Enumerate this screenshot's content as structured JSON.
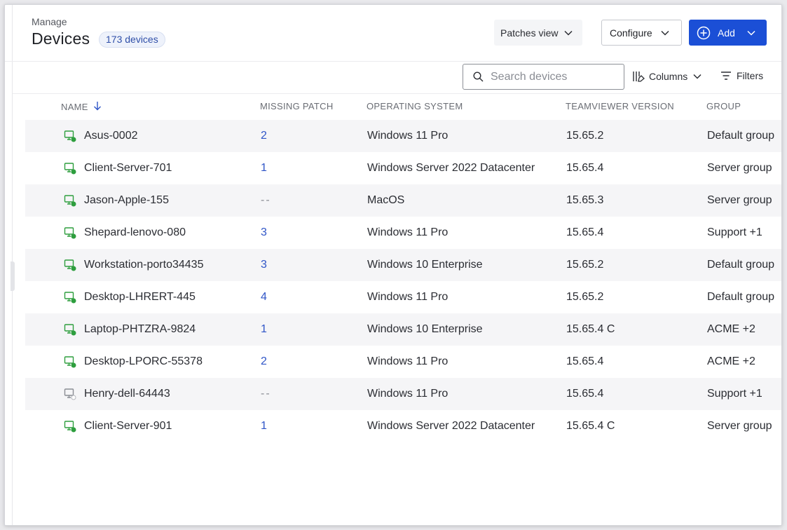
{
  "header": {
    "breadcrumb": "Manage",
    "title": "Devices",
    "count_badge": "173 devices",
    "patches_view_label": "Patches view",
    "configure_label": "Configure",
    "add_label": "Add"
  },
  "toolbar": {
    "search_placeholder": "Search devices",
    "columns_label": "Columns",
    "filters_label": "Filters"
  },
  "table": {
    "columns": [
      "NAME",
      "MISSING PATCH",
      "OPERATING SYSTEM",
      "TEAMVIEWER VERSION",
      "GROUP"
    ],
    "sort_column": "NAME",
    "sort_direction": "descending",
    "rows": [
      {
        "name": "Asus-0002",
        "missing_patch": "2",
        "os": "Windows 11 Pro",
        "version": "15.65.2",
        "group": "Default group",
        "online": true
      },
      {
        "name": "Client-Server-701",
        "missing_patch": "1",
        "os": "Windows Server 2022 Datacenter",
        "version": "15.65.4",
        "group": "Server group",
        "online": true
      },
      {
        "name": "Jason-Apple-155",
        "missing_patch": "--",
        "os": "MacOS",
        "version": "15.65.3",
        "group": "Server group",
        "online": true
      },
      {
        "name": "Shepard-lenovo-080",
        "missing_patch": "3",
        "os": "Windows 11 Pro",
        "version": "15.65.4",
        "group": "Support +1",
        "online": true
      },
      {
        "name": "Workstation-porto34435",
        "missing_patch": "3",
        "os": "Windows 10 Enterprise",
        "version": "15.65.2",
        "group": "Default group",
        "online": true
      },
      {
        "name": "Desktop-LHRERT-445",
        "missing_patch": "4",
        "os": "Windows 11 Pro",
        "version": "15.65.2",
        "group": "Default group",
        "online": true
      },
      {
        "name": "Laptop-PHTZRA-9824",
        "missing_patch": "1",
        "os": "Windows 10 Enterprise",
        "version": "15.65.4 C",
        "group": "ACME +2",
        "online": true
      },
      {
        "name": "Desktop-LPORC-55378",
        "missing_patch": "2",
        "os": "Windows 11 Pro",
        "version": "15.65.4",
        "group": "ACME +2",
        "online": true
      },
      {
        "name": "Henry-dell-64443",
        "missing_patch": "--",
        "os": "Windows 11 Pro",
        "version": "15.65.4",
        "group": "Support +1",
        "online": false
      },
      {
        "name": "Client-Server-901",
        "missing_patch": "1",
        "os": "Windows Server 2022 Datacenter",
        "version": "15.65.4 C",
        "group": "Server group",
        "online": true
      }
    ]
  },
  "colors": {
    "primary": "#1b4fd6",
    "link": "#2f55c7",
    "online": "#2e9e3e",
    "offline": "#9a9ca3",
    "row_stripe": "#f5f5f7"
  },
  "icons": {
    "sort": "arrow-down-icon",
    "search": "search-icon",
    "columns": "columns-icon",
    "filters": "filter-icon",
    "add": "plus-circle-icon",
    "device": "monitor-icon"
  }
}
